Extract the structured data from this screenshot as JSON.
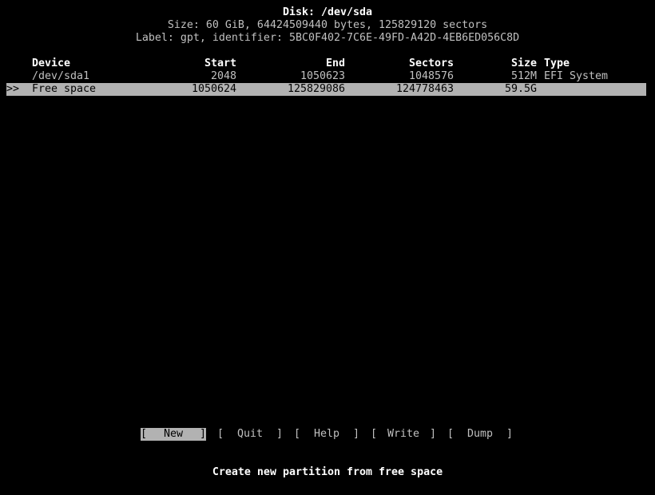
{
  "disk": {
    "title": "Disk: /dev/sda",
    "size_line": "Size: 60 GiB, 64424509440 bytes, 125829120 sectors",
    "label_line": "Label: gpt, identifier: 5BC0F402-7C6E-49FD-A42D-4EB6ED056C8D"
  },
  "table": {
    "headers": {
      "device": "Device",
      "start": "Start",
      "end": "End",
      "sectors": "Sectors",
      "size": "Size",
      "type": "Type"
    },
    "rows": [
      {
        "marker": "",
        "device": "/dev/sda1",
        "start": "2048",
        "end": "1050623",
        "sectors": "1048576",
        "size": "512M",
        "type": "EFI System"
      },
      {
        "marker": ">>",
        "device": "Free space",
        "start": "1050624",
        "end": "125829086",
        "sectors": "124778463",
        "size": "59.5G",
        "type": ""
      }
    ],
    "selected_row": 1
  },
  "menu": {
    "buttons": [
      {
        "label": "New",
        "active": true
      },
      {
        "label": "Quit",
        "active": false
      },
      {
        "label": "Help",
        "active": false
      },
      {
        "label": "Write",
        "active": false
      },
      {
        "label": "Dump",
        "active": false
      }
    ],
    "bracket_open": "[",
    "bracket_close": "]"
  },
  "help_text": "Create new partition from free space",
  "colors": {
    "background": "#000000",
    "text": "#c0c0c0",
    "highlight": "#b2b2b2"
  }
}
